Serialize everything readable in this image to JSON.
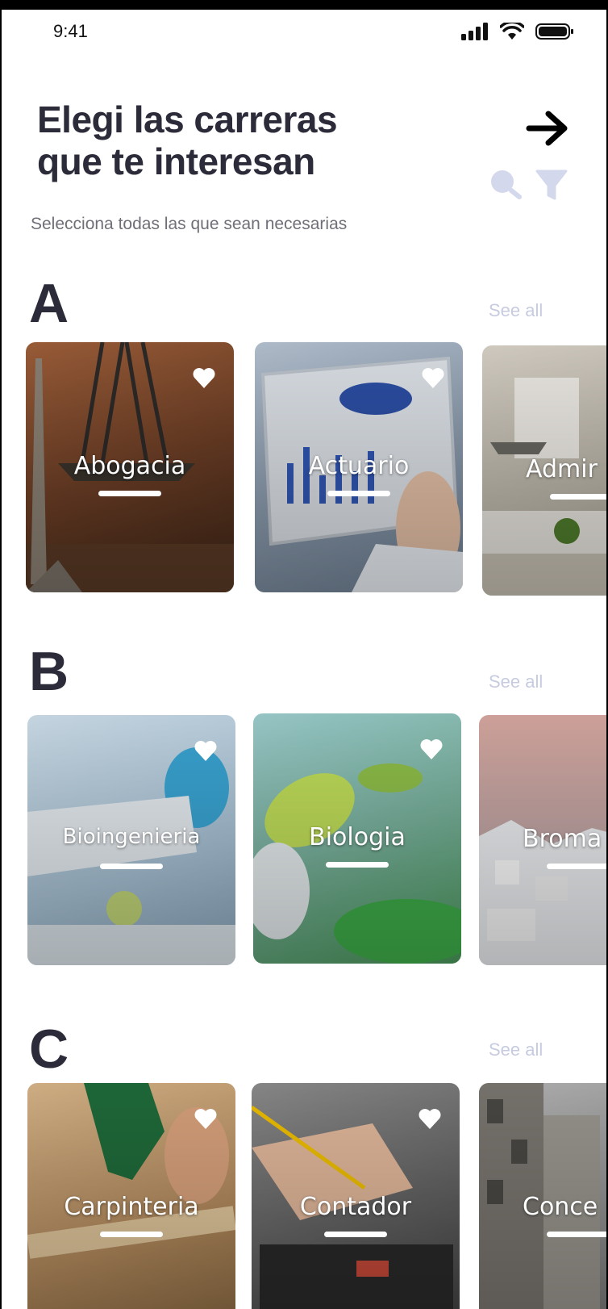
{
  "status_bar": {
    "time": "9:41"
  },
  "header": {
    "title_line1": "Elegi las carreras",
    "title_line2": "que te interesan",
    "subtitle": "Selecciona todas las que sean necesarias",
    "icons": [
      "arrow-right-icon",
      "search-icon",
      "filter-icon"
    ]
  },
  "sections": [
    {
      "letter": "A",
      "see_all": "See all",
      "cards": [
        {
          "label": "Abogacia",
          "color": "#7a4a2c"
        },
        {
          "label": "Actuario",
          "color": "#8a9fb5"
        },
        {
          "label": "Admir",
          "color": "#b9b3a6"
        }
      ]
    },
    {
      "letter": "B",
      "see_all": "See all",
      "cards": [
        {
          "label": "Bioingenieria",
          "color": "#9bb8cf"
        },
        {
          "label": "Biologia",
          "color": "#7fb6a4"
        },
        {
          "label": "Broma",
          "color": "#c6a7a5"
        }
      ]
    },
    {
      "letter": "C",
      "see_all": "See all",
      "cards": [
        {
          "label": "Carpinteria",
          "color": "#b38a5d"
        },
        {
          "label": "Contador",
          "color": "#6b6b6b"
        },
        {
          "label": "Conce",
          "color": "#8c8c8c"
        }
      ]
    }
  ],
  "colors": {
    "heading": "#2b2b3a",
    "see_all": "#c7cbe0",
    "muted_icon": "#d4d8ec"
  }
}
